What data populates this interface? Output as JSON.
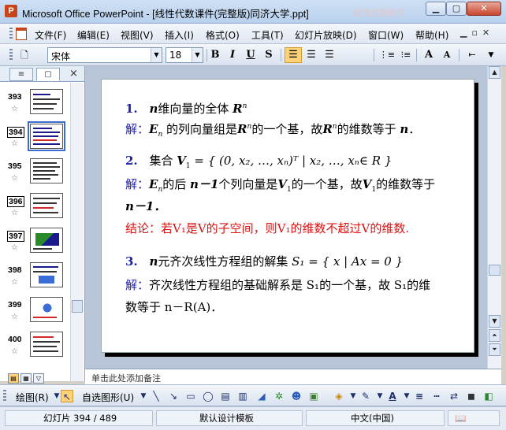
{
  "window": {
    "title": "Microsoft Office PowerPoint - [线性代数课件(完整版)同济大学.ppt]",
    "app_icon": "P",
    "ghost_text": "线性代数课件"
  },
  "menu": {
    "items": [
      "文件(F)",
      "编辑(E)",
      "视图(V)",
      "插入(I)",
      "格式(O)",
      "工具(T)",
      "幻灯片放映(D)",
      "窗口(W)",
      "帮助(H)"
    ]
  },
  "toolbar": {
    "font_name": "宋体",
    "font_size": "18",
    "bold": "B",
    "italic": "I",
    "underline": "U",
    "shadow": "S",
    "grow_font": "A",
    "shrink_font": "A"
  },
  "left_pane": {
    "tab_outline": "≡",
    "tab_slides": "▢",
    "close": "×",
    "current_slide": 394,
    "slides": [
      {
        "num": "393",
        "current": false,
        "boxed": false
      },
      {
        "num": "394",
        "current": true,
        "boxed": true
      },
      {
        "num": "395",
        "current": false,
        "boxed": false
      },
      {
        "num": "396",
        "current": false,
        "boxed": true
      },
      {
        "num": "397",
        "current": false,
        "boxed": true
      },
      {
        "num": "398",
        "current": false,
        "boxed": false
      },
      {
        "num": "399",
        "current": false,
        "boxed": false
      },
      {
        "num": "400",
        "current": false,
        "boxed": false
      }
    ],
    "star": "☆"
  },
  "slide": {
    "l1_num": "1.",
    "l1_n": "n",
    "l1_text": "维向量的全体",
    "l1_R": "R",
    "l1_sup": "n",
    "l2_jie": "解：",
    "l2_E": "E",
    "l2_sub": "n",
    "l2_a": "的列向量组是",
    "l2_R": "R",
    "l2_sup": "n",
    "l2_b": "的一个基，故",
    "l2_c": "的维数等于",
    "l2_n": "n",
    "l2_end": "．",
    "l3_num": "2.",
    "l3_text": "集合",
    "l3_V": "V",
    "l3_sub": "1",
    "l3_set": " = { (0, x₂, …, xₙ)ᵀ | x₂, …, xₙ∈ R }",
    "l4_jie": "解：",
    "l4_E": "E",
    "l4_sub": "n",
    "l4_a": "的后",
    "l4_nm": "n－1",
    "l4_b": "个列向量是",
    "l4_V": "V",
    "l4_vsub": "1",
    "l4_c": "的一个基，故",
    "l4_d": "的维数等于",
    "l5": "n－1．",
    "l6": "结论：若V₁是V的子空间，则V₁的维数不超过V的维数.",
    "l7_num": "3.",
    "l7_n": "n",
    "l7_text": "元齐次线性方程组的解集",
    "l7_set": "S₁ = { x | Ax = 0 }",
    "l8_jie": "解：",
    "l8_text": "齐次线性方程组的基础解系是 S₁的一个基，故 S₁的维",
    "l9_text": "数等于 n－R(A)．"
  },
  "notes": {
    "text": "单击此处添加备注"
  },
  "drawbar": {
    "draw_label": "绘图(R)",
    "autoshape_label": "自选图形(U)"
  },
  "status": {
    "slide_info": "幻灯片 394 / 489",
    "template": "默认设计模板",
    "language": "中文(中国)"
  }
}
